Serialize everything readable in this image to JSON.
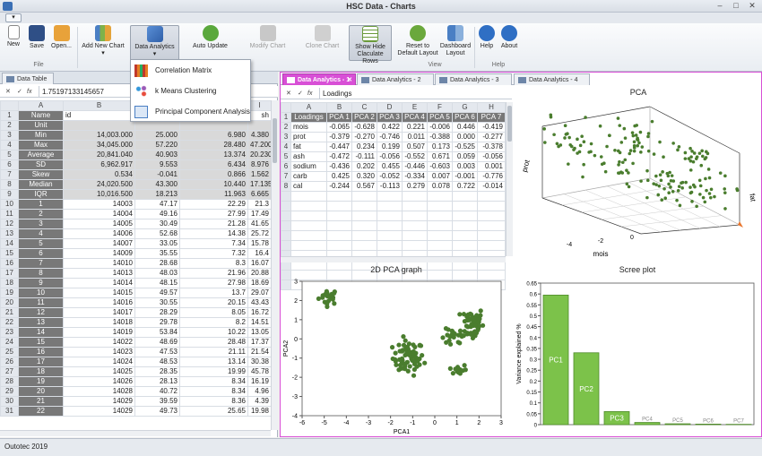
{
  "window": {
    "title": "HSC Data - Charts"
  },
  "ribbon": {
    "buttons": {
      "new": "New",
      "save": "Save",
      "open": "Open...",
      "add_new_chart": "Add New Chart",
      "data_analytics": "Data Analytics",
      "auto_update": "Auto Update",
      "modify_chart": "Modify Chart",
      "clone_chart": "Clone Chart",
      "show_hide_rows_1": "Show Hide",
      "show_hide_rows_2": "Claculate Rows",
      "reset_1": "Reset to",
      "reset_2": "Default Layout",
      "dashboard_1": "Dashboard",
      "dashboard_2": "Layout",
      "help": "Help",
      "about": "About"
    },
    "groups": {
      "file": "File",
      "view": "View",
      "help": "Help"
    }
  },
  "menu": {
    "items": [
      "Correlation Matrix",
      "k Means Clustering",
      "Principal Component Analysis"
    ]
  },
  "left_tab": {
    "label": "Data Table"
  },
  "left_formula": {
    "value": "1.75197133145657"
  },
  "left_grid": {
    "columns": [
      "A",
      "B",
      "C",
      "D",
      "I"
    ],
    "headers": [
      "Name",
      "id",
      "mois",
      "",
      "sh"
    ],
    "unit_label": "Unit",
    "stats": [
      {
        "name": "Min",
        "id": "14,003.000",
        "mois": "25.000",
        "d": "6.980",
        "ash": "4.380"
      },
      {
        "name": "Max",
        "id": "34,045.000",
        "mois": "57.220",
        "d": "28.480",
        "ash": "47.200"
      },
      {
        "name": "Average",
        "id": "20,841.040",
        "mois": "40.903",
        "d": "13.374",
        "ash": "20.230"
      },
      {
        "name": "SD",
        "id": "6,962.917",
        "mois": "9.553",
        "d": "6.434",
        "ash": "8.976"
      },
      {
        "name": "Skew",
        "id": "0.534",
        "mois": "-0.041",
        "d": "0.866",
        "ash": "1.562"
      },
      {
        "name": "Median",
        "id": "24,020.500",
        "mois": "43.300",
        "d": "10.440",
        "ash": "17.135"
      },
      {
        "name": "IQR",
        "id": "10,016.500",
        "mois": "18.213",
        "d": "11.963",
        "ash": "6.665"
      }
    ],
    "rows": [
      [
        "1",
        "14003",
        "47.17",
        "22.29",
        "21.3"
      ],
      [
        "2",
        "14004",
        "49.16",
        "27.99",
        "17.49"
      ],
      [
        "3",
        "14005",
        "30.49",
        "21.28",
        "41.65"
      ],
      [
        "4",
        "14006",
        "52.68",
        "14.38",
        "25.72"
      ],
      [
        "5",
        "14007",
        "33.05",
        "7.34",
        "15.78"
      ],
      [
        "6",
        "14009",
        "35.55",
        "7.32",
        "16.4"
      ],
      [
        "7",
        "14010",
        "28.68",
        "8.3",
        "16.07"
      ],
      [
        "8",
        "14013",
        "48.03",
        "21.96",
        "20.88"
      ],
      [
        "9",
        "14014",
        "48.15",
        "27.98",
        "18.69"
      ],
      [
        "10",
        "14015",
        "49.57",
        "13.7",
        "29.07"
      ],
      [
        "11",
        "14016",
        "30.55",
        "20.15",
        "43.43"
      ],
      [
        "12",
        "14017",
        "28.29",
        "8.05",
        "16.72"
      ],
      [
        "13",
        "14018",
        "29.78",
        "8.2",
        "14.51"
      ],
      [
        "14",
        "14019",
        "53.84",
        "10.22",
        "13.05"
      ],
      [
        "15",
        "14022",
        "48.69",
        "28.48",
        "17.37"
      ],
      [
        "16",
        "14023",
        "47.53",
        "21.11",
        "21.54"
      ],
      [
        "17",
        "14024",
        "48.53",
        "13.14",
        "30.38"
      ],
      [
        "18",
        "14025",
        "28.35",
        "19.99",
        "45.78"
      ],
      [
        "19",
        "14026",
        "28.13",
        "8.34",
        "16.19"
      ],
      [
        "20",
        "14028",
        "40.72",
        "8.34",
        "4.96"
      ],
      [
        "21",
        "14029",
        "39.59",
        "8.36",
        "4.39"
      ],
      [
        "22",
        "14029",
        "49.73",
        "25.65",
        "19.98"
      ]
    ]
  },
  "right_tabs": [
    "Data Analytics - 1",
    "Data Analytics - 2",
    "Data Analytics - 3",
    "Data Analytics - 4"
  ],
  "loadings": {
    "formula_value": "Loadings",
    "columns": [
      "A",
      "B",
      "C",
      "D",
      "E",
      "F",
      "G",
      "H"
    ],
    "header": [
      "Loadings",
      "PCA 1",
      "PCA 2",
      "PCA 3",
      "PCA 4",
      "PCA 5",
      "PCA 6",
      "PCA 7"
    ],
    "rows": [
      [
        "mois",
        "-0.065",
        "-0.628",
        "0.422",
        "0.221",
        "-0.006",
        "0.446",
        "-0.419"
      ],
      [
        "prot",
        "-0.379",
        "-0.270",
        "-0.746",
        "0.011",
        "-0.388",
        "0.000",
        "-0.277"
      ],
      [
        "fat",
        "-0.447",
        "0.234",
        "0.199",
        "0.507",
        "0.173",
        "-0.525",
        "-0.378"
      ],
      [
        "ash",
        "-0.472",
        "-0.111",
        "-0.056",
        "-0.552",
        "0.671",
        "0.059",
        "-0.056"
      ],
      [
        "sodium",
        "-0.436",
        "0.202",
        "0.455",
        "-0.446",
        "-0.603",
        "0.003",
        "0.001"
      ],
      [
        "carb",
        "0.425",
        "0.320",
        "-0.052",
        "-0.334",
        "0.007",
        "-0.001",
        "-0.776"
      ],
      [
        "cal",
        "-0.244",
        "0.567",
        "-0.113",
        "0.279",
        "0.078",
        "0.722",
        "-0.014"
      ]
    ]
  },
  "chart_data": [
    {
      "type": "scatter",
      "title": "PCA",
      "xlabel": "mois",
      "ylabel": "prot",
      "zlabel": "fat",
      "tick_labels": [
        "-4",
        "-2",
        "0"
      ]
    },
    {
      "type": "scatter",
      "title": "2D PCA graph",
      "xlabel": "PCA1",
      "ylabel": "PCA2",
      "xlim": [
        -6,
        3
      ],
      "ylim": [
        -4,
        3
      ],
      "xticks": [
        -6,
        -5,
        -4,
        -3,
        -2,
        -1,
        0,
        1,
        2,
        3
      ],
      "yticks": [
        -4,
        -3,
        -2,
        -1,
        0,
        1,
        2,
        3
      ],
      "clusters": [
        {
          "cx": -4.8,
          "cy": 2.2,
          "n": 22,
          "sx": 0.22,
          "sy": 0.2
        },
        {
          "cx": -1.2,
          "cy": -1.0,
          "n": 65,
          "sx": 0.35,
          "sy": 0.45
        },
        {
          "cx": 0.8,
          "cy": 0.0,
          "n": 18,
          "sx": 0.25,
          "sy": 0.25
        },
        {
          "cx": 1.7,
          "cy": 0.8,
          "n": 55,
          "sx": 0.25,
          "sy": 0.45
        },
        {
          "cx": 1.05,
          "cy": -1.6,
          "n": 14,
          "sx": 0.2,
          "sy": 0.15
        }
      ]
    },
    {
      "type": "bar",
      "title": "Scree plot",
      "ylabel": "Variance explained %",
      "categories": [
        "PC1",
        "PC2",
        "PC3",
        "PC4",
        "PC5",
        "PC6",
        "PC7"
      ],
      "values": [
        0.595,
        0.33,
        0.06,
        0.01,
        0.004,
        0.0025,
        0.0015
      ],
      "ylim": [
        0,
        0.65
      ],
      "yticks": [
        0,
        0.05,
        0.1,
        0.15,
        0.2,
        0.25,
        0.3,
        0.35,
        0.4,
        0.45,
        0.5,
        0.55,
        0.6,
        0.65
      ]
    }
  ],
  "colors": {
    "accent": "#d84fd6",
    "scatter": "#4a7d2e",
    "bar": "#7cc24a",
    "bar_edge": "#4f8a2a"
  },
  "status": {
    "text": "Outotec 2019"
  }
}
